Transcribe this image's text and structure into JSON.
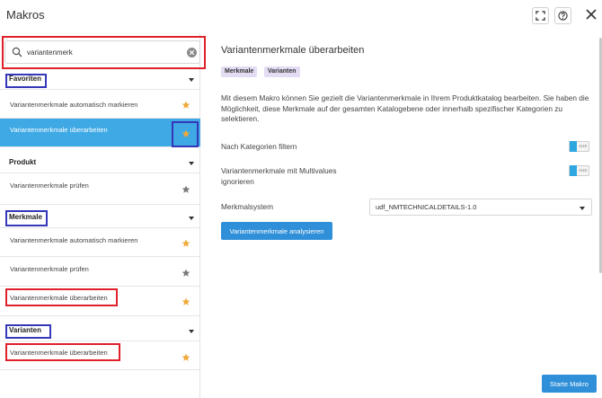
{
  "window": {
    "title": "Makros"
  },
  "search": {
    "value": "variantenmerk",
    "placeholder": ""
  },
  "left": {
    "groups": [
      {
        "label": "Favoriten",
        "items": [
          {
            "label": "Variantenmerkmale automatisch markieren",
            "starred": true
          },
          {
            "label": "Variantenmerkmale überarbeiten",
            "starred": true,
            "selected": true
          }
        ]
      },
      {
        "label": "Produkt",
        "items": [
          {
            "label": "Variantenmerkmale prüfen",
            "starred": false
          }
        ]
      },
      {
        "label": "Merkmale",
        "items": [
          {
            "label": "Variantenmerkmale automatisch markieren",
            "starred": true
          },
          {
            "label": "Variantenmerkmale prüfen",
            "starred": false
          },
          {
            "label": "Variantenmerkmale überarbeiten",
            "starred": true
          }
        ]
      },
      {
        "label": "Varianten",
        "items": [
          {
            "label": "Variantenmerkmale überarbeiten",
            "starred": true
          }
        ]
      }
    ]
  },
  "detail": {
    "title": "Variantenmerkmale überarbeiten",
    "tags": [
      "Merkmale",
      "Varianten"
    ],
    "description": "Mit diesem Makro können Sie gezielt die Variantenmerkmale in Ihrem Produktkatalog bearbeiten. Sie haben die Möglichkeit, diese Merkmale auf der gesamten Katalogebene oder innerhalb spezifischer Kategorien zu selektieren.",
    "settings": {
      "filter_label": "Nach Kategorien filtern",
      "filter_toggle": "AUS",
      "multivalue_label": "Variantenmerkmale mit Multivalues ignorieren",
      "multivalue_toggle": "AUS",
      "system_label": "Merkmalsystem",
      "system_value": "udf_NMTECHNICALDETAILS-1.0"
    },
    "analyse_button": "Variantenmerkmale analysieren",
    "start_button": "Starte Makro"
  },
  "colors": {
    "accent": "#2f8fd8",
    "selected_row": "#3fa9e5",
    "star_active": "#f0a93a",
    "star_inactive": "#7a7a7a",
    "highlight_red": "#e0202a",
    "highlight_blue": "#3437b8",
    "tag_bg": "#e3dcf3"
  },
  "icons": {
    "fullscreen": "fullscreen-icon",
    "help": "help-icon",
    "close": "close-icon",
    "search": "search-icon",
    "clear": "clear-icon",
    "star": "star-icon",
    "caret": "chevron-down-icon"
  }
}
